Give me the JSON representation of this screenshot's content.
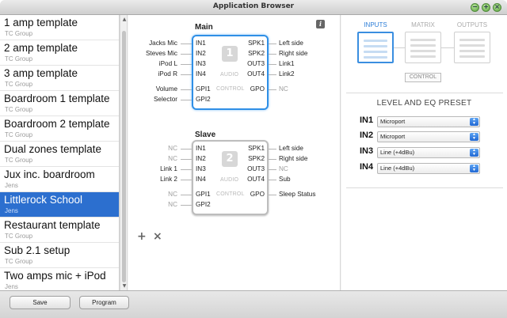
{
  "window": {
    "title": "Application Browser"
  },
  "templates": [
    {
      "name": "1 amp template",
      "owner": "TC Group"
    },
    {
      "name": "2 amp template",
      "owner": "TC Group"
    },
    {
      "name": "3 amp template",
      "owner": "TC Group"
    },
    {
      "name": "Boardroom 1 template",
      "owner": "TC Group"
    },
    {
      "name": "Boardroom 2 template",
      "owner": "TC Group"
    },
    {
      "name": "Dual zones template",
      "owner": "TC Group"
    },
    {
      "name": "Jux inc. boardroom",
      "owner": "Jens"
    },
    {
      "name": "Littlerock School",
      "owner": "Jens",
      "selected": true
    },
    {
      "name": "Restaurant template",
      "owner": "TC Group"
    },
    {
      "name": "Sub 2.1 setup",
      "owner": "TC Group"
    },
    {
      "name": "Two amps mic + iPod",
      "owner": "Jens"
    }
  ],
  "devices": {
    "main": {
      "title": "Main",
      "number": "1",
      "inputs": [
        {
          "port": "IN1",
          "label": "Jacks Mic"
        },
        {
          "port": "IN2",
          "label": "Steves Mic"
        },
        {
          "port": "IN3",
          "label": "iPod L"
        },
        {
          "port": "IN4",
          "label": "iPod R"
        }
      ],
      "outputs": [
        {
          "port": "SPK1",
          "label": "Left side"
        },
        {
          "port": "SPK2",
          "label": "Right side"
        },
        {
          "port": "OUT3",
          "label": "Link1"
        },
        {
          "port": "OUT4",
          "label": "Link2"
        }
      ],
      "audio_label": "AUDIO",
      "control_label": "CONTROL",
      "gpi": [
        {
          "port": "GPI1",
          "label": "Volume"
        },
        {
          "port": "GPI2",
          "label": "Selector"
        }
      ],
      "gpo": {
        "port": "GPO",
        "label": "NC"
      }
    },
    "slave": {
      "title": "Slave",
      "number": "2",
      "inputs": [
        {
          "port": "IN1",
          "label": "NC"
        },
        {
          "port": "IN2",
          "label": "NC"
        },
        {
          "port": "IN3",
          "label": "Link 1"
        },
        {
          "port": "IN4",
          "label": "Link 2"
        }
      ],
      "outputs": [
        {
          "port": "SPK1",
          "label": "Left side"
        },
        {
          "port": "SPK2",
          "label": "Right side"
        },
        {
          "port": "OUT3",
          "label": "NC"
        },
        {
          "port": "OUT4",
          "label": "Sub"
        }
      ],
      "audio_label": "AUDIO",
      "control_label": "CONTROL",
      "gpi": [
        {
          "port": "GPI1",
          "label": "NC"
        },
        {
          "port": "GPI2",
          "label": "NC"
        }
      ],
      "gpo": {
        "port": "GPO",
        "label": "Sleep Status"
      }
    }
  },
  "view_tabs": {
    "inputs": "INPUTS",
    "matrix": "MATRIX",
    "outputs": "OUTPUTS",
    "control": "CONTROL"
  },
  "eq_preset": {
    "title": "LEVEL AND EQ PRESET",
    "rows": [
      {
        "input": "IN1",
        "value": "Microport"
      },
      {
        "input": "IN2",
        "value": "Microport"
      },
      {
        "input": "IN3",
        "value": "Line (+4dBu)"
      },
      {
        "input": "IN4",
        "value": "Line (+4dBu)"
      }
    ]
  },
  "toolbar": {
    "save_label": "Save",
    "program_label": "Program"
  },
  "icons": {
    "info": "i",
    "add": "+",
    "remove": "×",
    "window_buttons": [
      "−",
      "+",
      "×"
    ]
  },
  "colors": {
    "selection": "#2c6fcf",
    "accent": "#2f8fe6"
  }
}
